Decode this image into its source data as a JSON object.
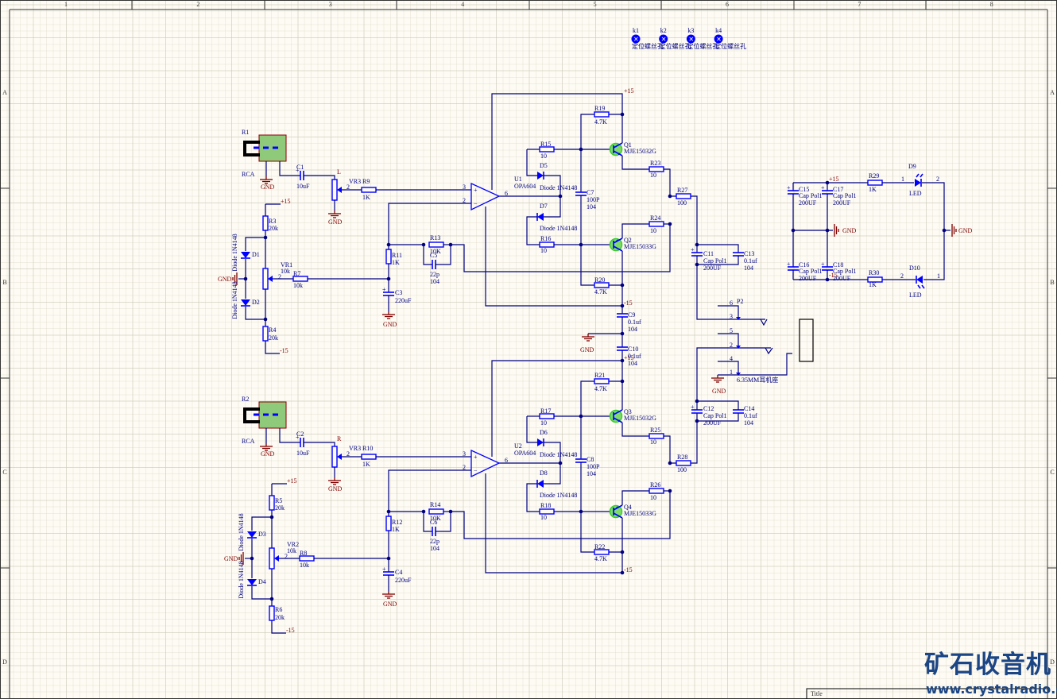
{
  "frame": {
    "columns": [
      "1",
      "2",
      "3",
      "4",
      "5",
      "6",
      "7",
      "8"
    ],
    "rows": [
      "A",
      "B",
      "C",
      "D"
    ],
    "title_label": "Title"
  },
  "logo": {
    "chinese": "矿石收音机",
    "url": "www.crystalradio.cn"
  },
  "colors": {
    "wire": "#000080",
    "component": "#0000ff",
    "power_label": "#800000",
    "transistor": "#7fdc6a",
    "jack": "#8fc97a",
    "logo": "#1b4584"
  },
  "mounting_holes": [
    {
      "ref": "k1",
      "label": "定位螺丝孔"
    },
    {
      "ref": "k2",
      "label": "定位螺丝孔"
    },
    {
      "ref": "k3",
      "label": "定位螺丝孔"
    },
    {
      "ref": "k4",
      "label": "定位螺丝孔"
    }
  ],
  "channels": [
    {
      "labels": {
        "jack_ref": "R1",
        "jack_type": "RCA",
        "jack_gnd": "GND",
        "c_in_ref": "C1",
        "c_in_val": "10uF",
        "vol_ch": "L",
        "vol_wiper_pin": "2",
        "vol_ref": "VR3",
        "r_in_ref": "R9",
        "r_in_val": "1K",
        "vol_gnd": "GND",
        "pos_rail": "+15",
        "rb1_ref": "R3",
        "rb1_val": "20k",
        "d1_ref": "D1",
        "d1_type": "Diode 1N4148",
        "gnd_bias": "GND",
        "vr_ref": "VR1",
        "vr_val": "10k",
        "vr_pin": "2",
        "rb_ref": "R7",
        "rb_val": "10k",
        "d2_ref": "D2",
        "d2_type": "Diode 1N4148",
        "rb2_ref": "R4",
        "rb2_val": "20k",
        "neg_rail": "-15",
        "rfb_ref": "R11",
        "rfb_val": "1K",
        "rf_ref": "R13",
        "rf_val": "10K",
        "cf_ref": "C5",
        "cf_val": "22p",
        "cf_code": "104",
        "cg_ref": "C3",
        "cg_val": "220uF",
        "cg_gnd": "GND",
        "u_ref": "U1",
        "u_type": "OPA604",
        "pin_plus": "3",
        "pin_minus": "2",
        "pin_out": "6",
        "r15_ref": "R15",
        "r15_val": "10",
        "d5_ref": "D5",
        "d5_type": "Diode 1N4148",
        "d7_ref": "D7",
        "d7_type": "Diode 1N4148",
        "r16_ref": "R16",
        "r16_val": "10",
        "c7_ref": "C7",
        "c7_val": "100P",
        "c7_code": "104",
        "pos2": "+15",
        "r19_ref": "R19",
        "r19_val": "4.7K",
        "q1_ref": "Q1",
        "q1_type": "MJE15032G",
        "r23_ref": "R23",
        "r23_val": "10",
        "r27_ref": "R27",
        "r27_val": "100",
        "r24_ref": "R24",
        "r24_val": "10",
        "q2_ref": "Q2",
        "q2_type": "MJE15033G",
        "r20_ref": "R20",
        "r20_val": "4.7K",
        "neg2": "-15",
        "c11_ref": "C11",
        "c11_type": "Cap Pol1",
        "c11_val": "200UF",
        "c13_ref": "C13",
        "c13_val": "0.1uf",
        "c13_code": "104"
      }
    },
    {
      "labels": {
        "jack_ref": "R2",
        "jack_type": "RCA",
        "jack_gnd": "GND",
        "c_in_ref": "C2",
        "c_in_val": "10uF",
        "vol_ch": "R",
        "vol_wiper_pin": "2",
        "vol_ref": "VR3",
        "r_in_ref": "R10",
        "r_in_val": "1K",
        "vol_gnd": "GND",
        "pos_rail": "+15",
        "rb1_ref": "R5",
        "rb1_val": "20k",
        "d1_ref": "D3",
        "d1_type": "Diode 1N4148",
        "gnd_bias": "GND",
        "vr_ref": "VR2",
        "vr_val": "10k",
        "vr_pin": "2",
        "rb_ref": "R8",
        "rb_val": "10k",
        "d2_ref": "D4",
        "d2_type": "Diode 1N4148",
        "rb2_ref": "R6",
        "rb2_val": "20k",
        "neg_rail": "-15",
        "rfb_ref": "R12",
        "rfb_val": "1K",
        "rf_ref": "R14",
        "rf_val": "10K",
        "cf_ref": "C6",
        "cf_val": "22p",
        "cf_code": "104",
        "cg_ref": "C4",
        "cg_val": "220uF",
        "cg_gnd": "GND",
        "u_ref": "U2",
        "u_type": "OPA604",
        "pin_plus": "3",
        "pin_minus": "2",
        "pin_out": "6",
        "r15_ref": "R17",
        "r15_val": "10",
        "d5_ref": "D6",
        "d5_type": "Diode 1N4148",
        "d7_ref": "D8",
        "d7_type": "Diode 1N4148",
        "r16_ref": "R18",
        "r16_val": "10",
        "c7_ref": "C8",
        "c7_val": "100P",
        "c7_code": "104",
        "pos2": "+15",
        "r19_ref": "R21",
        "r19_val": "4.7K",
        "q1_ref": "Q3",
        "q1_type": "MJE15032G",
        "r23_ref": "R25",
        "r23_val": "10",
        "r27_ref": "R28",
        "r27_val": "100",
        "r24_ref": "R26",
        "r24_val": "10",
        "q2_ref": "Q4",
        "q2_type": "MJE15033G",
        "r20_ref": "R22",
        "r20_val": "4.7K",
        "neg2": "-15",
        "c11_ref": "C12",
        "c11_type": "Cap Pol1",
        "c11_val": "200UF",
        "c13_ref": "C14",
        "c13_val": "0.1uf",
        "c13_code": "104"
      }
    }
  ],
  "decoupling": {
    "c9_ref": "C9",
    "c9_val": "0.1uf",
    "c9_code": "104",
    "c10_ref": "C10",
    "c10_val": "0.1uf",
    "c10_code": "104",
    "gnd": "GND"
  },
  "power": {
    "pos_rail": "+15",
    "neg_rail": "-15",
    "c15_ref": "C15",
    "c15_type": "Cap Pol1",
    "c15_val": "200UF",
    "c17_ref": "C17",
    "c17_type": "Cap Pol1",
    "c17_val": "200UF",
    "c16_ref": "C16",
    "c16_type": "Cap Pol1",
    "c16_val": "200UF",
    "c18_ref": "C18",
    "c18_type": "Cap Pol1",
    "c18_val": "200UF",
    "r29_ref": "R29",
    "r29_val": "1K",
    "r30_ref": "R30",
    "r30_val": "1K",
    "d9_ref": "D9",
    "d9_type": "LED",
    "d9_pin1": "1",
    "d9_pin2": "2",
    "d10_ref": "D10",
    "d10_type": "LED",
    "d10_pin1": "1",
    "d10_pin2": "2",
    "gnd_mid": "GND",
    "gnd_right": "GND"
  },
  "jack_out": {
    "ref": "P2",
    "type": "6.35MM耳机座",
    "pins": [
      "6",
      "3",
      "5",
      "2",
      "4",
      "1"
    ],
    "gnd": "GND"
  }
}
